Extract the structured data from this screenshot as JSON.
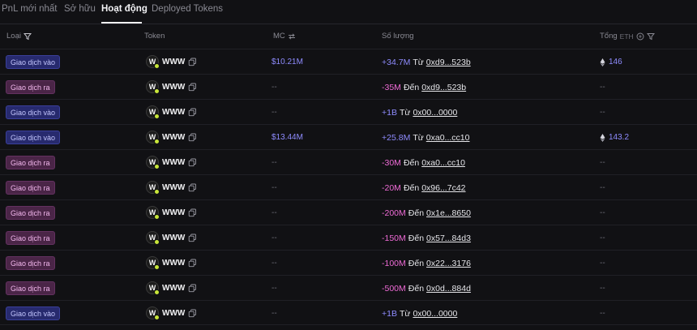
{
  "tabs": [
    {
      "label": "PnL mới nhất",
      "active": false
    },
    {
      "label": "Sở hữu",
      "active": false
    },
    {
      "label": "Hoạt động",
      "active": true
    },
    {
      "label": "Deployed Tokens",
      "active": false
    }
  ],
  "header": {
    "type": "Loại",
    "token": "Token",
    "mc": "MC",
    "amount": "Số lượng",
    "total": "Tổng",
    "total_unit": "ETH"
  },
  "colors": {
    "buy": "#8f8cff",
    "sell": "#ef6bd6",
    "background": "#111114"
  },
  "icons": {
    "filter": "filter-icon",
    "swap": "swap-icon",
    "copy": "copy-icon",
    "eth": "eth-icon",
    "currency": "currency-icon"
  },
  "rows": [
    {
      "type": "Giao dịch vào",
      "kind": "buy",
      "token": "WWW",
      "mc": "$10.21M",
      "amount": "+34.7M",
      "dir": "Từ",
      "addr": "0xd9...523b",
      "total": "146"
    },
    {
      "type": "Giao dịch ra",
      "kind": "sell",
      "token": "WWW",
      "mc": "--",
      "amount": "-35M",
      "dir": "Đến",
      "addr": "0xd9...523b",
      "total": "--"
    },
    {
      "type": "Giao dịch vào",
      "kind": "buy",
      "token": "WWW",
      "mc": "--",
      "amount": "+1B",
      "dir": "Từ",
      "addr": "0x00...0000",
      "total": "--"
    },
    {
      "type": "Giao dịch vào",
      "kind": "buy",
      "token": "WWW",
      "mc": "$13.44M",
      "amount": "+25.8M",
      "dir": "Từ",
      "addr": "0xa0...cc10",
      "total": "143.2"
    },
    {
      "type": "Giao dịch ra",
      "kind": "sell",
      "token": "WWW",
      "mc": "--",
      "amount": "-30M",
      "dir": "Đến",
      "addr": "0xa0...cc10",
      "total": "--"
    },
    {
      "type": "Giao dịch ra",
      "kind": "sell",
      "token": "WWW",
      "mc": "--",
      "amount": "-20M",
      "dir": "Đến",
      "addr": "0x96...7c42",
      "total": "--"
    },
    {
      "type": "Giao dịch ra",
      "kind": "sell",
      "token": "WWW",
      "mc": "--",
      "amount": "-200M",
      "dir": "Đến",
      "addr": "0x1e...8650",
      "total": "--"
    },
    {
      "type": "Giao dịch ra",
      "kind": "sell",
      "token": "WWW",
      "mc": "--",
      "amount": "-150M",
      "dir": "Đến",
      "addr": "0x57...84d3",
      "total": "--"
    },
    {
      "type": "Giao dịch ra",
      "kind": "sell",
      "token": "WWW",
      "mc": "--",
      "amount": "-100M",
      "dir": "Đến",
      "addr": "0x22...3176",
      "total": "--"
    },
    {
      "type": "Giao dịch ra",
      "kind": "sell",
      "token": "WWW",
      "mc": "--",
      "amount": "-500M",
      "dir": "Đến",
      "addr": "0x0d...884d",
      "total": "--"
    },
    {
      "type": "Giao dịch vào",
      "kind": "buy",
      "token": "WWW",
      "mc": "--",
      "amount": "+1B",
      "dir": "Từ",
      "addr": "0x00...0000",
      "total": "--"
    }
  ]
}
